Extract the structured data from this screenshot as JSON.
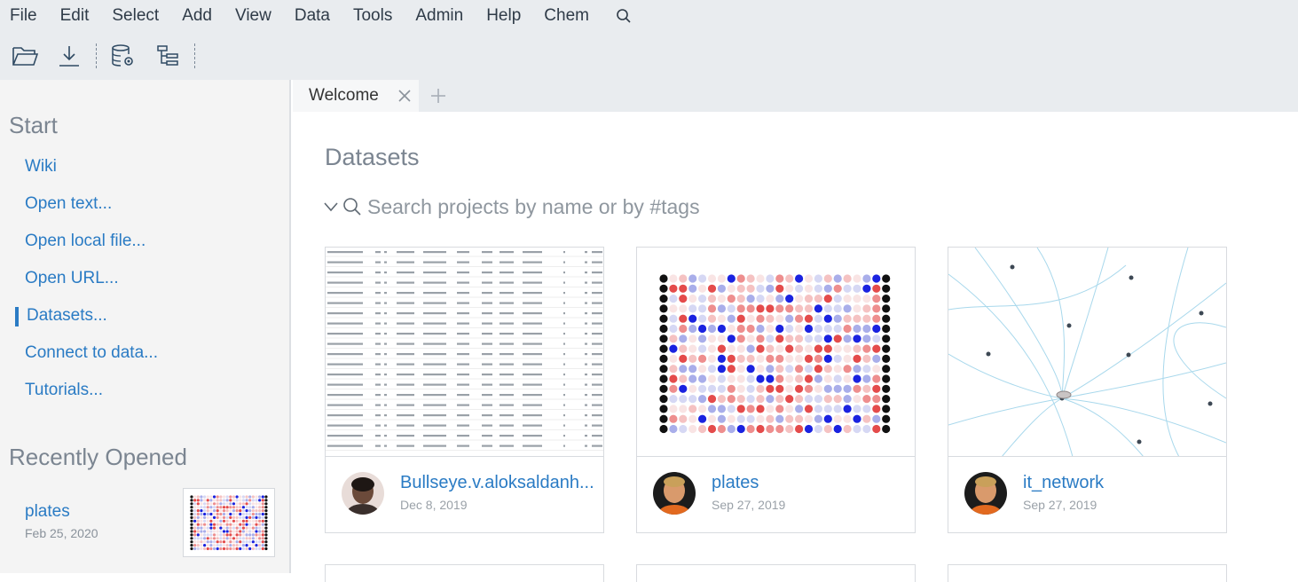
{
  "menu": {
    "items": [
      "File",
      "Edit",
      "Select",
      "Add",
      "View",
      "Data",
      "Tools",
      "Admin",
      "Help",
      "Chem"
    ]
  },
  "toolbar": {
    "icons": [
      "open-folder-icon",
      "download-icon",
      "database-gear-icon",
      "tree-view-icon"
    ]
  },
  "sidebar": {
    "start_heading": "Start",
    "links": [
      "Wiki",
      "Open text...",
      "Open local file...",
      "Open URL...",
      "Datasets...",
      "Connect to data...",
      "Tutorials..."
    ],
    "active_link": "Datasets...",
    "recent_heading": "Recently Opened",
    "recent": {
      "name": "plates",
      "date": "Feb 25, 2020"
    }
  },
  "tabs": {
    "items": [
      {
        "label": "Welcome"
      }
    ]
  },
  "main": {
    "title": "Datasets",
    "search": {
      "placeholder": "Search projects by name or by #tags"
    },
    "cards": [
      {
        "name": "Bullseye.v.aloksaldanh...",
        "date": "Dec 8, 2019"
      },
      {
        "name": "plates",
        "date": "Sep 27, 2019"
      },
      {
        "name": "it_network",
        "date": "Sep 27, 2019"
      }
    ]
  },
  "colors": {
    "link": "#2a7bc4",
    "heading_gray": "#7b8591",
    "chrome": "#e9ecef"
  }
}
